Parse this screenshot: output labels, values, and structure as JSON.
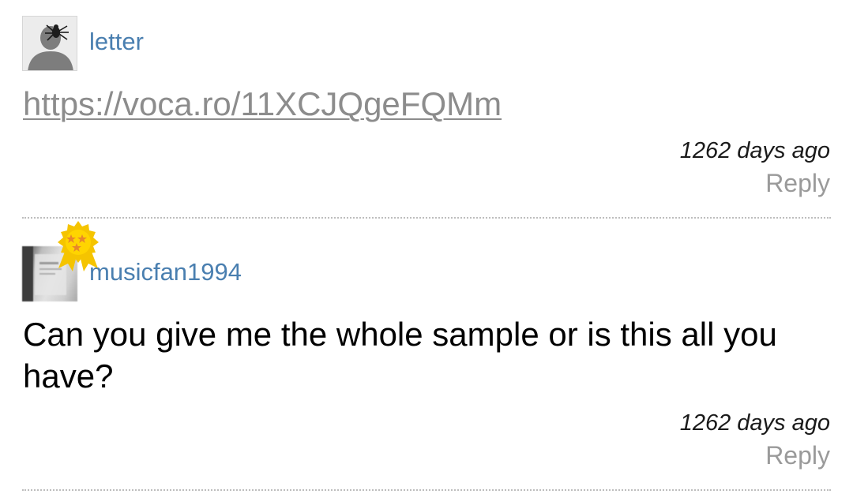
{
  "comments": [
    {
      "username": "letter",
      "avatar_icon": "default-silhouette-with-spider-icon",
      "body_link": "https://voca.ro/11XCJQgeFQMm",
      "timestamp": "1262 days ago",
      "reply_label": "Reply"
    },
    {
      "username": "musicfan1994",
      "avatar_icon": "user-photo-avatar",
      "badge_icon": "star-rosette-badge-icon",
      "body_text": "Can you give me the whole sample or is this all you have?",
      "timestamp": "1262 days ago",
      "reply_label": "Reply"
    }
  ],
  "colors": {
    "username": "#4a7fb0",
    "link": "#8c8c8c",
    "reply": "#9a9a9a",
    "badge_gold": "#f5c400",
    "badge_star": "#e8862a"
  }
}
